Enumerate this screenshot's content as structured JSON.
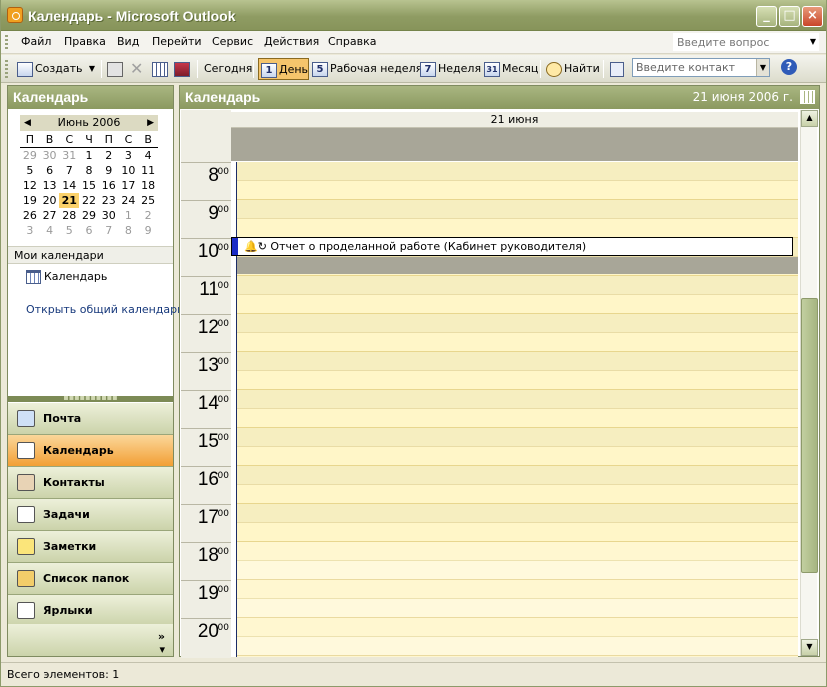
{
  "window": {
    "title": "Календарь - Microsoft Outlook"
  },
  "menu": {
    "items": [
      "Файл",
      "Правка",
      "Вид",
      "Перейти",
      "Сервис",
      "Действия",
      "Справка"
    ],
    "ask_placeholder": "Введите вопрос"
  },
  "toolbar": {
    "create": "Создать",
    "today": "Сегодня",
    "day": "День",
    "day_num": "1",
    "workweek": "Рабочая неделя",
    "workweek_num": "5",
    "week": "Неделя",
    "week_num": "7",
    "month": "Месяц",
    "month_num": "31",
    "find": "Найти",
    "contact_placeholder": "Введите контакт"
  },
  "navpane": {
    "title": "Календарь",
    "mini": {
      "month": "Июнь 2006",
      "dow": [
        "П",
        "В",
        "С",
        "Ч",
        "П",
        "С",
        "В"
      ],
      "weeks": [
        [
          "29",
          "30",
          "31",
          "1",
          "2",
          "3",
          "4"
        ],
        [
          "5",
          "6",
          "7",
          "8",
          "9",
          "10",
          "11"
        ],
        [
          "12",
          "13",
          "14",
          "15",
          "16",
          "17",
          "18"
        ],
        [
          "19",
          "20",
          "21",
          "22",
          "23",
          "24",
          "25"
        ],
        [
          "26",
          "27",
          "28",
          "29",
          "30",
          "1",
          "2"
        ],
        [
          "3",
          "4",
          "5",
          "6",
          "7",
          "8",
          "9"
        ]
      ],
      "today": "21"
    },
    "my_calendars": "Мои календари",
    "calendar_item": "Календарь",
    "open_shared": "Открыть общий календарь..."
  },
  "nav_buttons": [
    {
      "label": "Почта",
      "icon": "mail-icon",
      "color": "#cfe0f7"
    },
    {
      "label": "Календарь",
      "icon": "calendar-icon",
      "color": "#ffffff"
    },
    {
      "label": "Контакты",
      "icon": "contacts-icon",
      "color": "#e8d3b5"
    },
    {
      "label": "Задачи",
      "icon": "tasks-icon",
      "color": "#ffffff"
    },
    {
      "label": "Заметки",
      "icon": "notes-icon",
      "color": "#fbe57a"
    },
    {
      "label": "Список папок",
      "icon": "folder-list-icon",
      "color": "#f3cd6a"
    },
    {
      "label": "Ярлыки",
      "icon": "shortcuts-icon",
      "color": "#ffffff"
    }
  ],
  "calendar": {
    "title": "Календарь",
    "date": "21 июня 2006 г.",
    "day_header": "21 июня",
    "hours": [
      "8",
      "9",
      "10",
      "11",
      "12",
      "13",
      "14",
      "15",
      "16",
      "17",
      "18",
      "19",
      "20"
    ],
    "minutes": "00",
    "appointment": "Отчет о проделанной работе (Кабинет руководителя)"
  },
  "status": {
    "text": "Всего элементов: 1"
  }
}
